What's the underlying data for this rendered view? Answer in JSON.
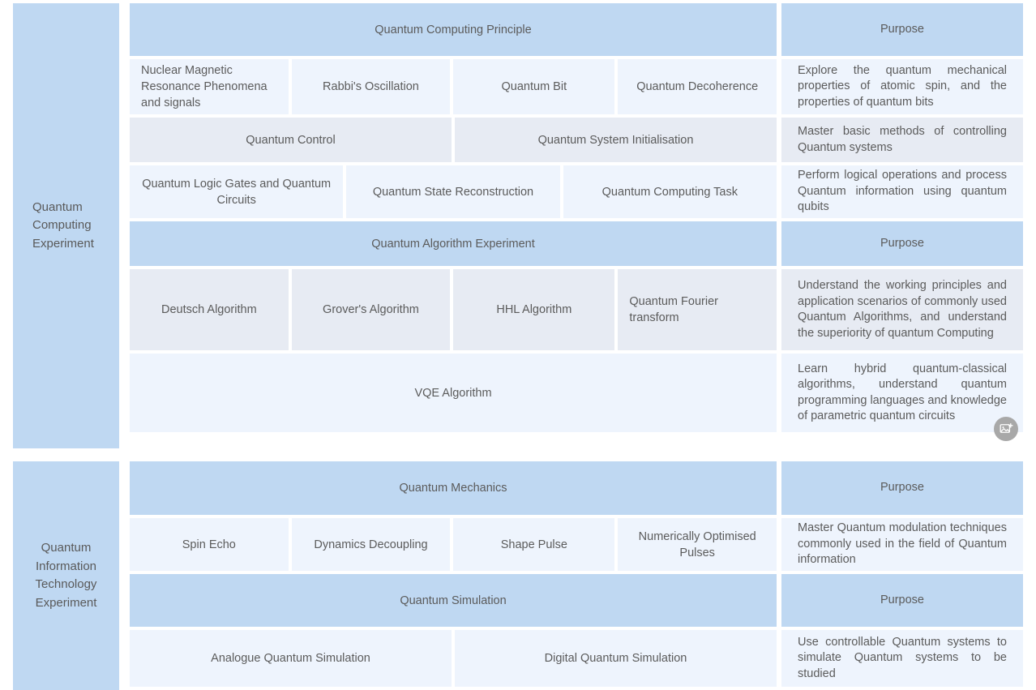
{
  "sections": [
    {
      "sidebar_label": "Quantum\nComputing\nExperiment",
      "sidebar_align": "left",
      "rows": [
        {
          "tone": "head",
          "align": "center",
          "cells": [
            {
              "label": "Quantum Computing Principle",
              "flex": 1
            }
          ],
          "purpose": {
            "tone": "head",
            "label": "Purpose",
            "head": true
          }
        },
        {
          "tone": "light",
          "align": "left",
          "cells": [
            {
              "label": "Nuclear Magnetic Resonance Phenomena and signals",
              "flex": 195
            },
            {
              "label": "Rabbi's Oscillation",
              "flex": 195,
              "align": "center"
            },
            {
              "label": "Quantum Bit",
              "flex": 199,
              "align": "center"
            },
            {
              "label": "Quantum Decoherence",
              "flex": 195,
              "align": "center"
            }
          ],
          "purpose": {
            "tone": "light",
            "label": "Explore the quantum mechanical properties of atomic spin, and the properties of quantum bits"
          }
        },
        {
          "tone": "grey",
          "align": "center",
          "cells": [
            {
              "label": "Quantum Control",
              "flex": 398
            },
            {
              "label": "Quantum System Initialisation",
              "flex": 398
            }
          ],
          "purpose": {
            "tone": "grey",
            "label": "Master basic methods of controlling Quantum systems"
          }
        },
        {
          "tone": "light",
          "align": "center",
          "cells": [
            {
              "label": "Quantum Logic Gates and Quantum Circuits",
              "flex": 262
            },
            {
              "label": "Quantum State Reconstruction",
              "flex": 262
            },
            {
              "label": "Quantum Computing Task",
              "flex": 262
            }
          ],
          "purpose": {
            "tone": "light",
            "label": "Perform logical operations and process Quantum information using quantum qubits"
          }
        },
        {
          "tone": "head",
          "align": "center",
          "cells": [
            {
              "label": "Quantum Algorithm Experiment",
              "flex": 1
            }
          ],
          "purpose": {
            "tone": "head",
            "label": "Purpose",
            "head": true
          }
        },
        {
          "tone": "grey",
          "align": "center",
          "cells": [
            {
              "label": "Deutsch Algorithm",
              "flex": 195
            },
            {
              "label": "Grover's Algorithm",
              "flex": 195
            },
            {
              "label": "HHL Algorithm",
              "flex": 199
            },
            {
              "label": "Quantum Fourier transform",
              "flex": 195,
              "align": "left"
            }
          ],
          "purpose": {
            "tone": "grey",
            "label": "Understand the working principles and application scenarios of commonly used Quantum Algorithms, and understand the superiority of quantum Computing"
          }
        },
        {
          "tone": "light",
          "align": "center",
          "cells": [
            {
              "label": "VQE Algorithm",
              "flex": 1
            }
          ],
          "purpose": {
            "tone": "light",
            "label": "Learn hybrid quantum-classical algorithms, understand quantum programming languages and knowledge of parametric quantum circuits"
          }
        }
      ]
    },
    {
      "sidebar_label": "Quantum\nInformation\nTechnology\nExperiment",
      "sidebar_align": "center",
      "rows": [
        {
          "tone": "head",
          "align": "center",
          "cells": [
            {
              "label": "Quantum Mechanics",
              "flex": 1
            }
          ],
          "purpose": {
            "tone": "head",
            "label": "Purpose",
            "head": true
          }
        },
        {
          "tone": "light",
          "align": "center",
          "cells": [
            {
              "label": "Spin Echo",
              "flex": 195
            },
            {
              "label": "Dynamics Decoupling",
              "flex": 195
            },
            {
              "label": "Shape Pulse",
              "flex": 199
            },
            {
              "label": "Numerically Optimised Pulses",
              "flex": 195
            }
          ],
          "purpose": {
            "tone": "light",
            "label": "Master Quantum modulation techniques commonly used in the field of Quantum information"
          }
        },
        {
          "tone": "head",
          "align": "center",
          "cells": [
            {
              "label": "Quantum Simulation",
              "flex": 1
            }
          ],
          "purpose": {
            "tone": "head",
            "label": "Purpose",
            "head": true
          }
        },
        {
          "tone": "light",
          "align": "center",
          "cells": [
            {
              "label": "Analogue Quantum Simulation",
              "flex": 398
            },
            {
              "label": "Digital Quantum Simulation",
              "flex": 398
            }
          ],
          "purpose": {
            "tone": "light",
            "label": "Use controllable Quantum systems to simulate Quantum systems to be studied"
          }
        }
      ]
    }
  ],
  "fab": {
    "icon": "add-image-icon"
  },
  "colors": {
    "header_blue": "#bfd8f2",
    "row_grey": "#e7ebf3",
    "row_light": "#eef4fd",
    "text": "#5b5b5b"
  }
}
